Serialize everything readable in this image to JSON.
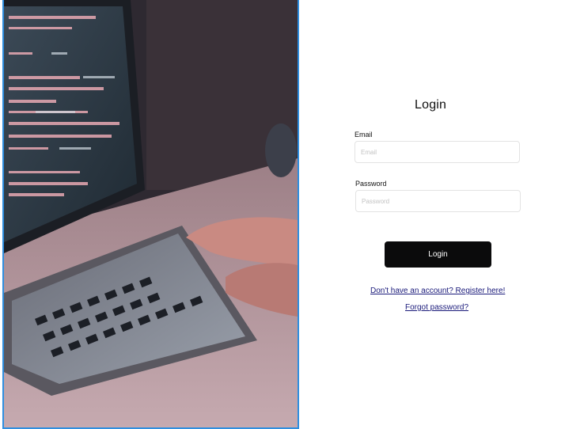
{
  "hero": {
    "image_semantic": "laptop-coding-photo",
    "border_color": "#2f8fe0"
  },
  "form": {
    "title": "Login",
    "email": {
      "label": "Email",
      "placeholder": "Email",
      "value": ""
    },
    "password": {
      "label": "Password",
      "placeholder": "Password",
      "value": ""
    },
    "submit_label": "Login",
    "register_link": "Don't have an account? Register here!",
    "forgot_link": "Forgot password?"
  },
  "colors": {
    "button_bg": "#0b0b0c",
    "link": "#1a1a7a"
  }
}
